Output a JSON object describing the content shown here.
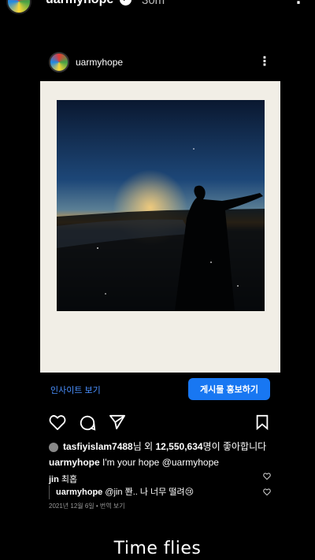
{
  "story": {
    "username": "uarmyhope",
    "verified_mark": "✓",
    "time": "30m",
    "more_icon": "more-vertical-icon"
  },
  "post": {
    "username": "uarmyhope",
    "insight_label": "인사이트 보기",
    "promote_label": "게시물 홍보하기",
    "likes": {
      "user": "tasfiyislam7488",
      "connector": "님 외 ",
      "count": "12,550,634",
      "suffix": "명이 좋아합니다"
    },
    "caption": {
      "user": "uarmyhope",
      "text": "I'm your hope @uarmyhope"
    },
    "comments": [
      {
        "user": "jin",
        "text": "최홉"
      }
    ],
    "reply": {
      "user": "uarmyhope",
      "text": "@jin 쫜.. 나 너무 떨려😢"
    },
    "date": "2021년 12월 6일",
    "translate_label": "번역 보기"
  },
  "story_caption": "Time flies",
  "colors": {
    "background": "#000000",
    "accent_blue": "#1877f2",
    "link_blue": "#4a90ff",
    "photo_frame": "#f1eee6"
  }
}
